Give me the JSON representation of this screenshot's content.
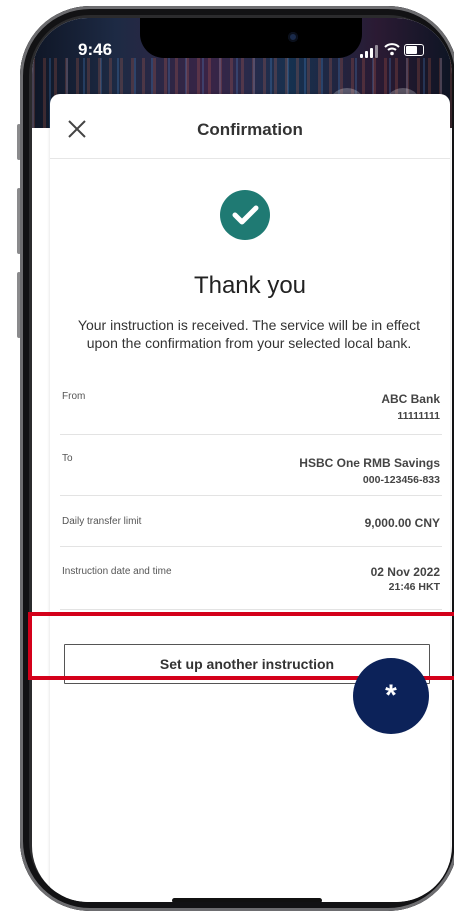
{
  "status_bar": {
    "time": "9:46",
    "icons": [
      "signal-icon",
      "wifi-icon",
      "battery-icon"
    ]
  },
  "header": {
    "title": "Confirmation",
    "close_icon": "close-icon"
  },
  "confirmation": {
    "icon": "check-circle-icon",
    "icon_color": "#1f7a73",
    "heading": "Thank you",
    "message": "Your instruction is received.  The service will be in effect upon the confirmation from your selected local bank."
  },
  "details": [
    {
      "label": "From",
      "value": "ABC Bank",
      "sub_value": "11111111"
    },
    {
      "label": "To",
      "value": "HSBC  One RMB Savings",
      "sub_value": "000-123456-833"
    },
    {
      "label": "Daily transfer limit",
      "value": "9,000.00 CNY",
      "sub_value": ""
    },
    {
      "label": "Instruction date and time",
      "value": "02 Nov 2022",
      "sub_value": "21:46 HKT"
    }
  ],
  "actions": {
    "setup_another_label": "Set up another instruction"
  },
  "annotation": {
    "highlight_color": "#d4001a",
    "badge_symbol": "*",
    "badge_color": "#0c2259"
  }
}
